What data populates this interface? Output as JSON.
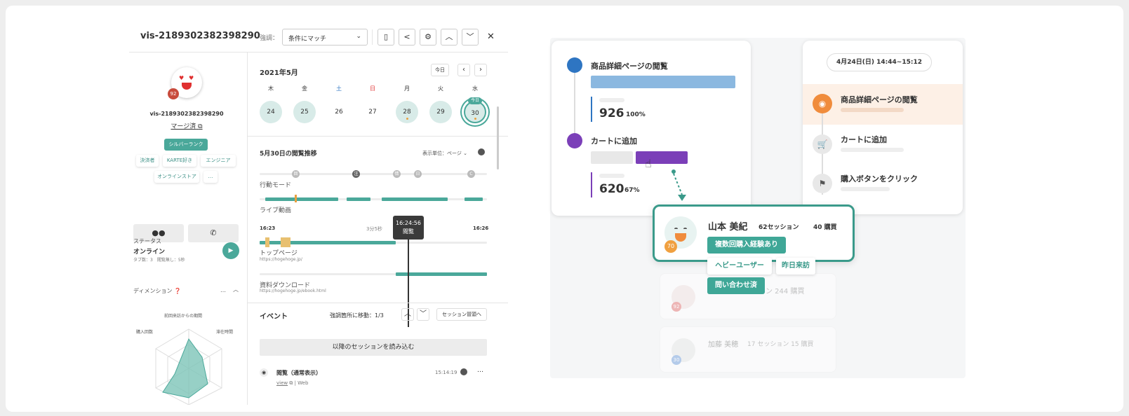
{
  "left_panel": {
    "visitor_id": "vis-2189302382398290",
    "highlight_label": "強調：",
    "highlight_select": "条件にマッチ",
    "avatar_badge": "92",
    "visitor_id_small": "vis-2189302382398290",
    "merge_link": "マージ済",
    "rank_pill": "シルバーランク",
    "tags": [
      "決済者",
      "KARTE好き",
      "エンジニア",
      "オンラインストア",
      "…"
    ],
    "status_heading": "ステータス",
    "status_value": "オンライン",
    "status_detail": "タブ数：3　閲覧無し：5秒",
    "dimension_label": "ディメンション",
    "radar_top": "前回来訪からの期間",
    "radar_left": "購入回数",
    "radar_right": "滞在時間"
  },
  "calendar": {
    "month": "2021年5月",
    "today_btn": "今日",
    "weekdays": [
      "木",
      "金",
      "土",
      "日",
      "月",
      "火",
      "水"
    ],
    "dates": [
      "24",
      "25",
      "26",
      "27",
      "28",
      "29",
      "30"
    ],
    "today_badge": "今日"
  },
  "timeline": {
    "title": "5月30日の閲覧推移",
    "unit_label": "表示単位：",
    "unit_value": "ページ",
    "nodes": [
      "回",
      "注",
      "情",
      "日",
      "C"
    ],
    "row1": "行動モード",
    "row2": "ライブ動画",
    "time_start": "16:23",
    "duration": "3分5秒",
    "time_end": "16:26",
    "tooltip_time": "16:24:56",
    "tooltip_label": "閲覧",
    "page1": "トップページ",
    "page1_url": "https://hogehoge.jp/",
    "page2": "資料ダウンロード",
    "page2_url": "https://hogehoge.jp/ebook.html"
  },
  "events": {
    "title": "イベント",
    "jump_label": "強調箇所に移動：1/3",
    "session_btn": "セッション冒頭へ",
    "load_btn": "以降のセッションを読み込む",
    "event_name": "閲覧（通常表示）",
    "event_time": "15:14:19",
    "event_view": "view",
    "event_web": "Web"
  },
  "funnel": {
    "step1": "商品詳細ページの閲覧",
    "step1_count": "926",
    "step1_pct": "100%",
    "step2": "カートに追加",
    "step2_count": "620",
    "step2_pct": "67%"
  },
  "journey": {
    "date_range": "4月24日(日) 14:44~15:12",
    "items": [
      "商品詳細ページの閲覧",
      "カートに追加",
      "購入ボタンをクリック"
    ]
  },
  "user_card": {
    "name": "山本 美紀",
    "sessions": "62セッション",
    "purchases": "40 購買",
    "badge": "70",
    "tags": [
      "複数回購入経験あり",
      "ヘビーユーザー",
      "昨日来訪",
      "問い合わせ済"
    ]
  },
  "faded_cards": [
    {
      "badge": "92",
      "text": "ッション  244 購買"
    },
    {
      "badge": "30",
      "name": "加藤 美穂",
      "text": "17 セッション  15 購買"
    }
  ],
  "colors": {
    "teal": "#4aa89a",
    "blue": "#2e75c2",
    "purple": "#7b3fb8",
    "orange": "#f08c3c"
  }
}
